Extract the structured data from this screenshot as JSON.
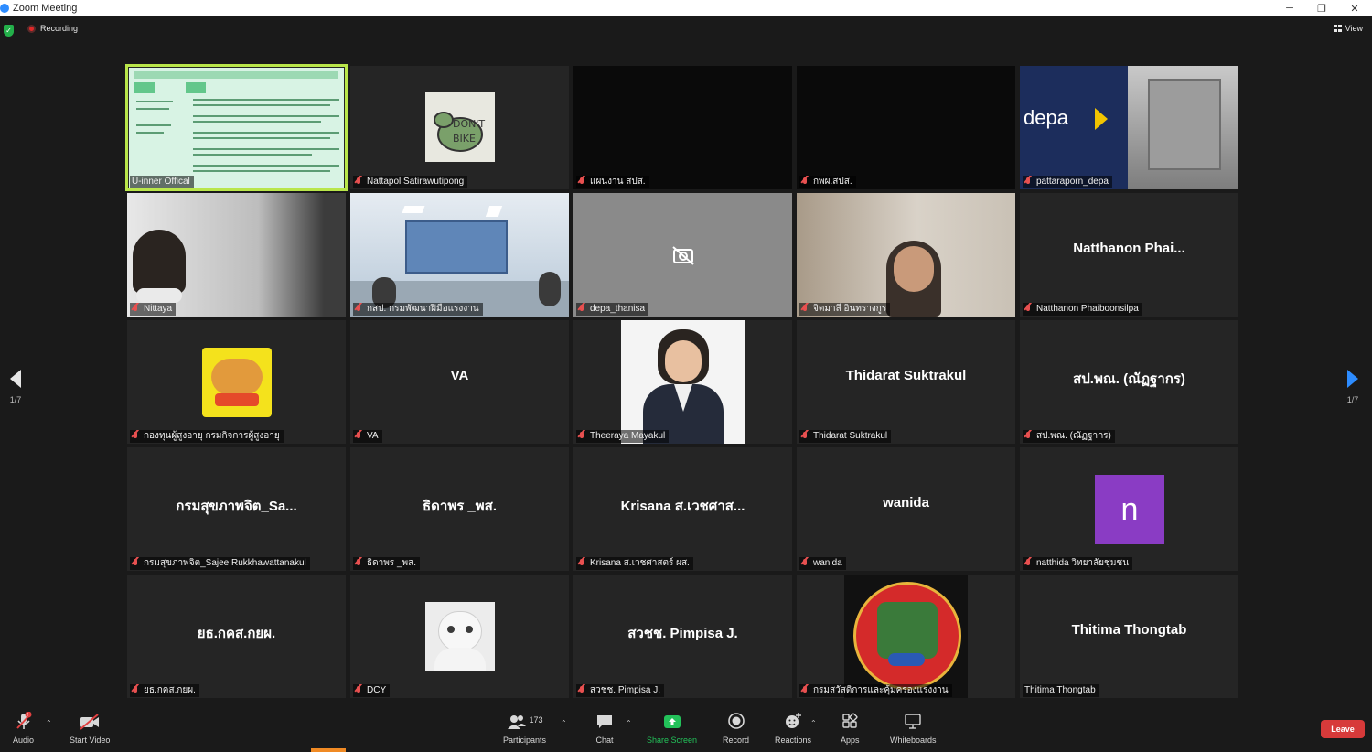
{
  "window": {
    "title": "Zoom Meeting",
    "minimize": "─",
    "maximize": "❐",
    "close": "✕"
  },
  "topbar": {
    "recording_label": "Recording",
    "view_label": "View"
  },
  "pager": {
    "left_label": "1/7",
    "right_label": "1/7"
  },
  "tiles": [
    {
      "caption": "U-inner Offical",
      "big": ""
    },
    {
      "caption": "Nattapol Satirawutipong",
      "big": ""
    },
    {
      "caption": "แผนงาน สปส.",
      "big": ""
    },
    {
      "caption": "กพผ.สปส.",
      "big": ""
    },
    {
      "caption": "pattaraporn_depa",
      "big": "",
      "logo_text": "depa"
    },
    {
      "caption": "Nittaya",
      "big": ""
    },
    {
      "caption": "กสป. กรมพัฒนาฝีมือแรงงาน",
      "big": ""
    },
    {
      "caption": "depa_thanisa",
      "big": ""
    },
    {
      "caption": "จิตมาลี อินทรางกูร",
      "big": ""
    },
    {
      "caption": "Natthanon Phaiboonsilpa",
      "big": "Natthanon Phai..."
    },
    {
      "caption": "กองทุนผู้สูงอายุ กรมกิจการผู้สูงอายุ",
      "big": ""
    },
    {
      "caption": "VA",
      "big": "VA"
    },
    {
      "caption": "Theeraya Mayakul",
      "big": ""
    },
    {
      "caption": "Thidarat Suktrakul",
      "big": "Thidarat Suktrakul"
    },
    {
      "caption": "สป.พณ. (ณัฏฐากร)",
      "big": "สป.พณ. (ณัฏฐากร)"
    },
    {
      "caption": "กรมสุขภาพจิต_Sajee Rukkhawattanakul",
      "big": "กรมสุขภาพจิต_Sa..."
    },
    {
      "caption": "ธิดาพร _พส.",
      "big": "ธิดาพร _พส."
    },
    {
      "caption": "Krisana ส.เวชศาสตร์ ผส.",
      "big": "Krisana ส.เวชศาส..."
    },
    {
      "caption": "wanida",
      "big": "wanida"
    },
    {
      "caption": "natthida วิทยาลัยชุมชน",
      "big": "",
      "avatar_letter": "n"
    },
    {
      "caption": "ยธ.กคส.กยผ.",
      "big": "ยธ.กคส.กยผ."
    },
    {
      "caption": "DCY",
      "big": ""
    },
    {
      "caption": "สวชช. Pimpisa J.",
      "big": "สวชช. Pimpisa J."
    },
    {
      "caption": "กรมสวัสดิการและคุ้มครองแรงงาน",
      "big": ""
    },
    {
      "caption": "Thitima Thongtab",
      "big": "Thitima Thongtab"
    }
  ],
  "toolbar": {
    "audio": "Audio",
    "start_video": "Start Video",
    "participants": "Participants",
    "participants_count": "173",
    "chat": "Chat",
    "share_screen": "Share Screen",
    "record": "Record",
    "reactions": "Reactions",
    "apps": "Apps",
    "whiteboards": "Whiteboards",
    "leave": "Leave",
    "audio_badge": "!"
  },
  "colors": {
    "share_green": "#23c25a",
    "leave_red": "#d73a3a",
    "active_outline": "#b9e64a",
    "accent_blue": "#2d8cff"
  }
}
